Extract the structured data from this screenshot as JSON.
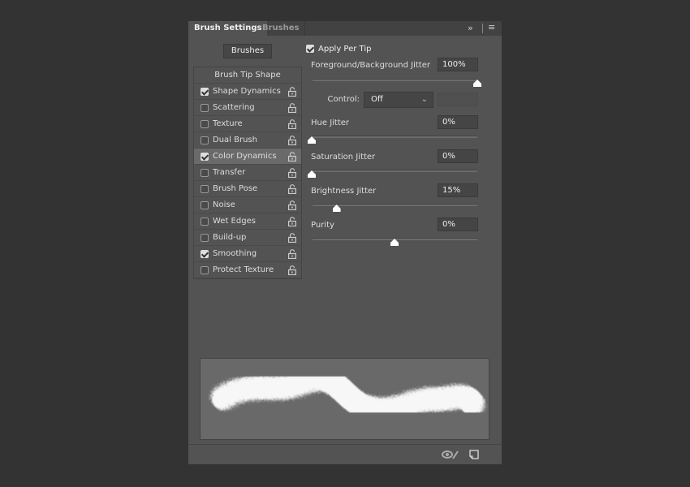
{
  "tabs": [
    "Brush Settings",
    "Brushes"
  ],
  "brushes_button": "Brushes",
  "list": [
    {
      "label": "Brush Tip Shape",
      "header": true
    },
    {
      "label": "Shape Dynamics",
      "checked": true
    },
    {
      "label": "Scattering",
      "checked": false
    },
    {
      "label": "Texture",
      "checked": false
    },
    {
      "label": "Dual Brush",
      "checked": false
    },
    {
      "label": "Color Dynamics",
      "checked": true,
      "selected": true
    },
    {
      "label": "Transfer",
      "checked": false
    },
    {
      "label": "Brush Pose",
      "checked": false
    },
    {
      "label": "Noise",
      "checked": false
    },
    {
      "label": "Wet Edges",
      "checked": false
    },
    {
      "label": "Build-up",
      "checked": false
    },
    {
      "label": "Smoothing",
      "checked": true
    },
    {
      "label": "Protect Texture",
      "checked": false
    }
  ],
  "apply_per_tip": {
    "label": "Apply Per Tip",
    "checked": true
  },
  "control": {
    "label": "Control:",
    "value": "Off"
  },
  "settings": [
    {
      "label": "Foreground/Background Jitter",
      "value": "100%",
      "fraction": 1.0
    },
    {
      "label": "Hue Jitter",
      "value": "0%",
      "fraction": 0.0
    },
    {
      "label": "Saturation Jitter",
      "value": "0%",
      "fraction": 0.0
    },
    {
      "label": "Brightness Jitter",
      "value": "15%",
      "fraction": 0.15
    },
    {
      "label": "Purity",
      "value": "0%",
      "fraction": 0.5
    }
  ]
}
